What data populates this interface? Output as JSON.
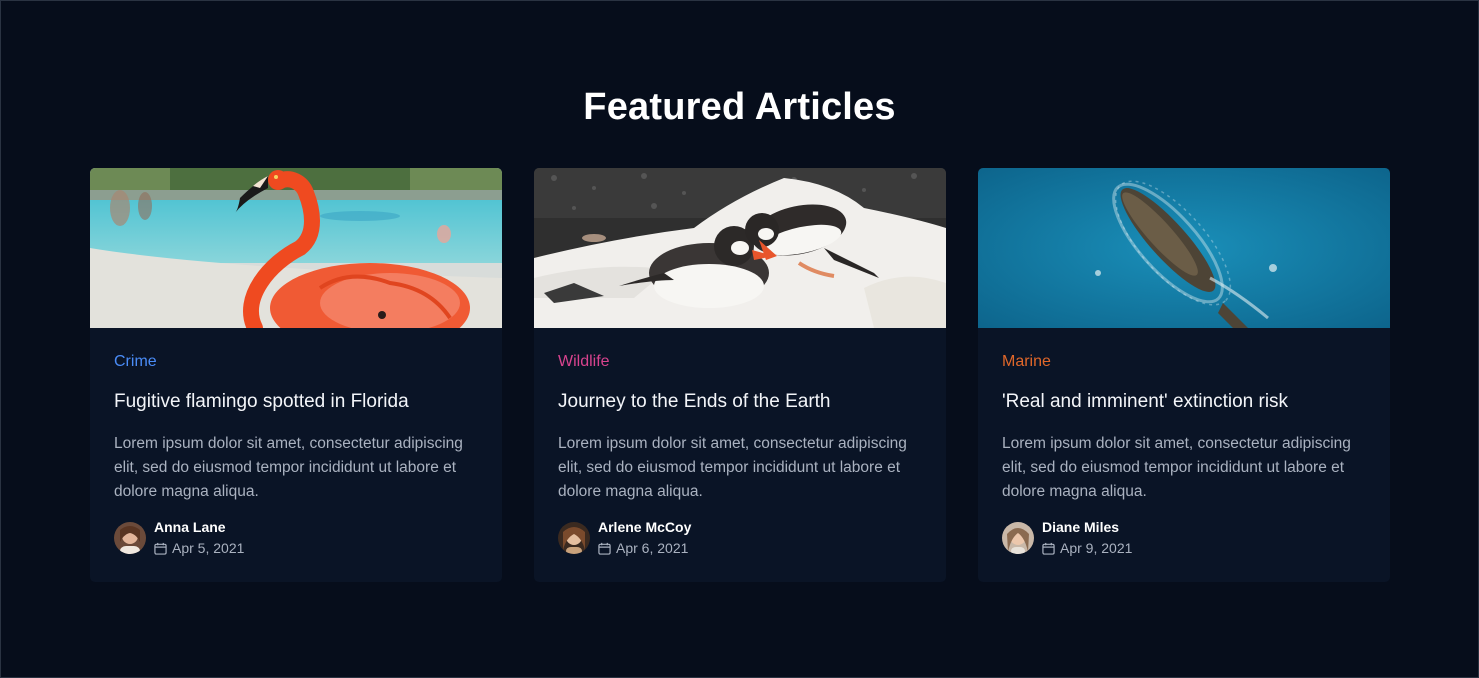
{
  "page": {
    "title": "Featured Articles"
  },
  "articles": [
    {
      "category": "Crime",
      "category_color": "#4a8cf7",
      "title": "Fugitive flamingo spotted in Florida",
      "excerpt": "Lorem ipsum dolor sit amet, consectetur adipiscing elit, sed do eiusmod tempor incididunt ut labore et dolore magna aliqua.",
      "author": "Anna Lane",
      "date": "Apr 5, 2021",
      "image": "flamingo-photo"
    },
    {
      "category": "Wildlife",
      "category_color": "#d8438e",
      "title": "Journey to the Ends of the Earth",
      "excerpt": "Lorem ipsum dolor sit amet, consectetur adipiscing elit, sed do eiusmod tempor incididunt ut labore et dolore magna aliqua.",
      "author": "Arlene McCoy",
      "date": "Apr 6, 2021",
      "image": "penguins-photo"
    },
    {
      "category": "Marine",
      "category_color": "#e0672a",
      "title": "'Real and imminent' extinction risk",
      "excerpt": "Lorem ipsum dolor sit amet, consectetur adipiscing elit, sed do eiusmod tempor incididunt ut labore et dolore magna aliqua.",
      "author": "Diane Miles",
      "date": "Apr 9, 2021",
      "image": "whale-photo"
    }
  ]
}
